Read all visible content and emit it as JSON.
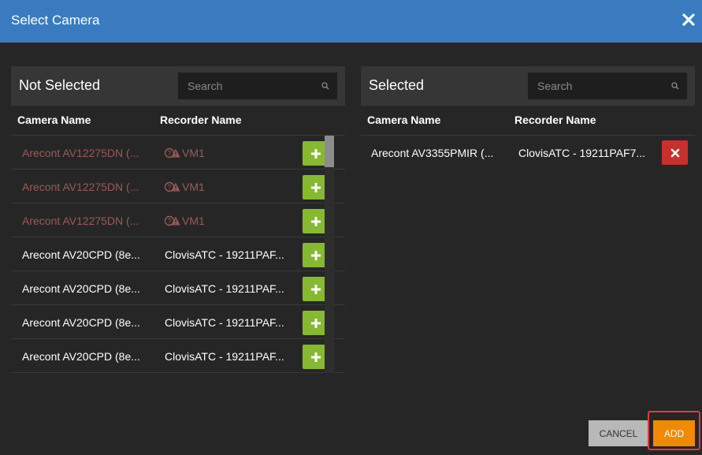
{
  "dialog": {
    "title": "Select Camera",
    "close_icon": "close-icon"
  },
  "left": {
    "title": "Not Selected",
    "search_placeholder": "Search",
    "col_camera": "Camera Name",
    "col_recorder": "Recorder Name",
    "rows": [
      {
        "camera": "Arecont AV12275DN (...",
        "recorder": "VM1",
        "warning": true
      },
      {
        "camera": "Arecont AV12275DN (...",
        "recorder": "VM1",
        "warning": true
      },
      {
        "camera": "Arecont AV12275DN (...",
        "recorder": "VM1",
        "warning": true
      },
      {
        "camera": "Arecont AV20CPD (8e...",
        "recorder": "ClovisATC - 19211PAF...",
        "warning": false
      },
      {
        "camera": "Arecont AV20CPD (8e...",
        "recorder": "ClovisATC - 19211PAF...",
        "warning": false
      },
      {
        "camera": "Arecont AV20CPD (8e...",
        "recorder": "ClovisATC - 19211PAF...",
        "warning": false
      },
      {
        "camera": "Arecont AV20CPD (8e...",
        "recorder": "ClovisATC - 19211PAF...",
        "warning": false
      }
    ]
  },
  "right": {
    "title": "Selected",
    "search_placeholder": "Search",
    "col_camera": "Camera Name",
    "col_recorder": "Recorder Name",
    "rows": [
      {
        "camera": "Arecont AV3355PMIR (...",
        "recorder": "ClovisATC - 19211PAF7..."
      }
    ]
  },
  "footer": {
    "cancel_label": "CANCEL",
    "add_label": "ADD"
  },
  "colors": {
    "header": "#3a7bbf",
    "add_green": "#86b92f",
    "remove_red": "#c9302c",
    "primary_orange": "#f08a00",
    "warning_text": "#9a5b57"
  }
}
